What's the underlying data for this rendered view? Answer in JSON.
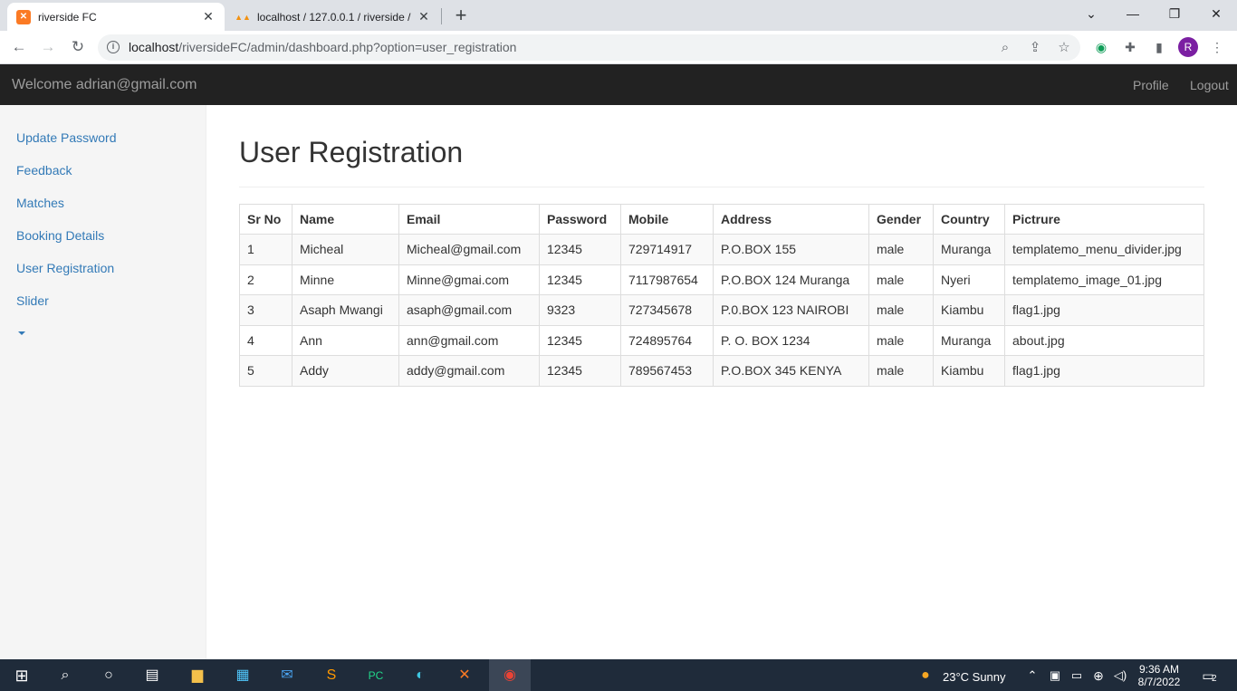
{
  "browser": {
    "tabs": [
      {
        "title": "riverside FC",
        "close": "✕"
      },
      {
        "title": "localhost / 127.0.0.1 / riverside / ",
        "close": "✕"
      }
    ],
    "new_tab": "+",
    "url_host": "localhost",
    "url_path": "/riversideFC/admin/dashboard.php?option=user_registration",
    "avatar_letter": "R"
  },
  "appnav": {
    "brand": "Welcome adrian@gmail.com",
    "profile": "Profile",
    "logout": "Logout"
  },
  "sidebar": {
    "items": [
      {
        "label": "Update Password"
      },
      {
        "label": "Feedback"
      },
      {
        "label": "Matches"
      },
      {
        "label": "Booking Details"
      },
      {
        "label": "User Registration"
      },
      {
        "label": "Slider"
      }
    ]
  },
  "main": {
    "title": "User Registration",
    "table": {
      "headers": [
        "Sr No",
        "Name",
        "Email",
        "Password",
        "Mobile",
        "Address",
        "Gender",
        "Country",
        "Pictrure"
      ],
      "rows": [
        [
          "1",
          "Micheal",
          "Micheal@gmail.com",
          "12345",
          "729714917",
          "P.O.BOX 155",
          "male",
          "Muranga",
          "templatemo_menu_divider.jpg"
        ],
        [
          "2",
          "Minne",
          "Minne@gmai.com",
          "12345",
          "7117987654",
          "P.O.BOX 124 Muranga",
          "male",
          "Nyeri",
          "templatemo_image_01.jpg"
        ],
        [
          "3",
          "Asaph Mwangi",
          "asaph@gmail.com",
          "9323",
          "727345678",
          "P.0.BOX 123 NAIROBI",
          "male",
          "Kiambu",
          "flag1.jpg"
        ],
        [
          "4",
          "Ann",
          "ann@gmail.com",
          "12345",
          "724895764",
          "P. O. BOX 1234",
          "male",
          "Muranga",
          "about.jpg"
        ],
        [
          "5",
          "Addy",
          "addy@gmail.com",
          "12345",
          "789567453",
          "P.O.BOX 345 KENYA",
          "male",
          "Kiambu",
          "flag1.jpg"
        ]
      ]
    }
  },
  "taskbar": {
    "weather": "23°C  Sunny",
    "time": "9:36 AM",
    "date": "8/7/2022",
    "notifications": "2"
  },
  "colors": {
    "navbar_bg": "#222222",
    "link": "#337ab7",
    "sidebar_bg": "#f5f5f5",
    "taskbar_bg": "#1f2b3a"
  }
}
